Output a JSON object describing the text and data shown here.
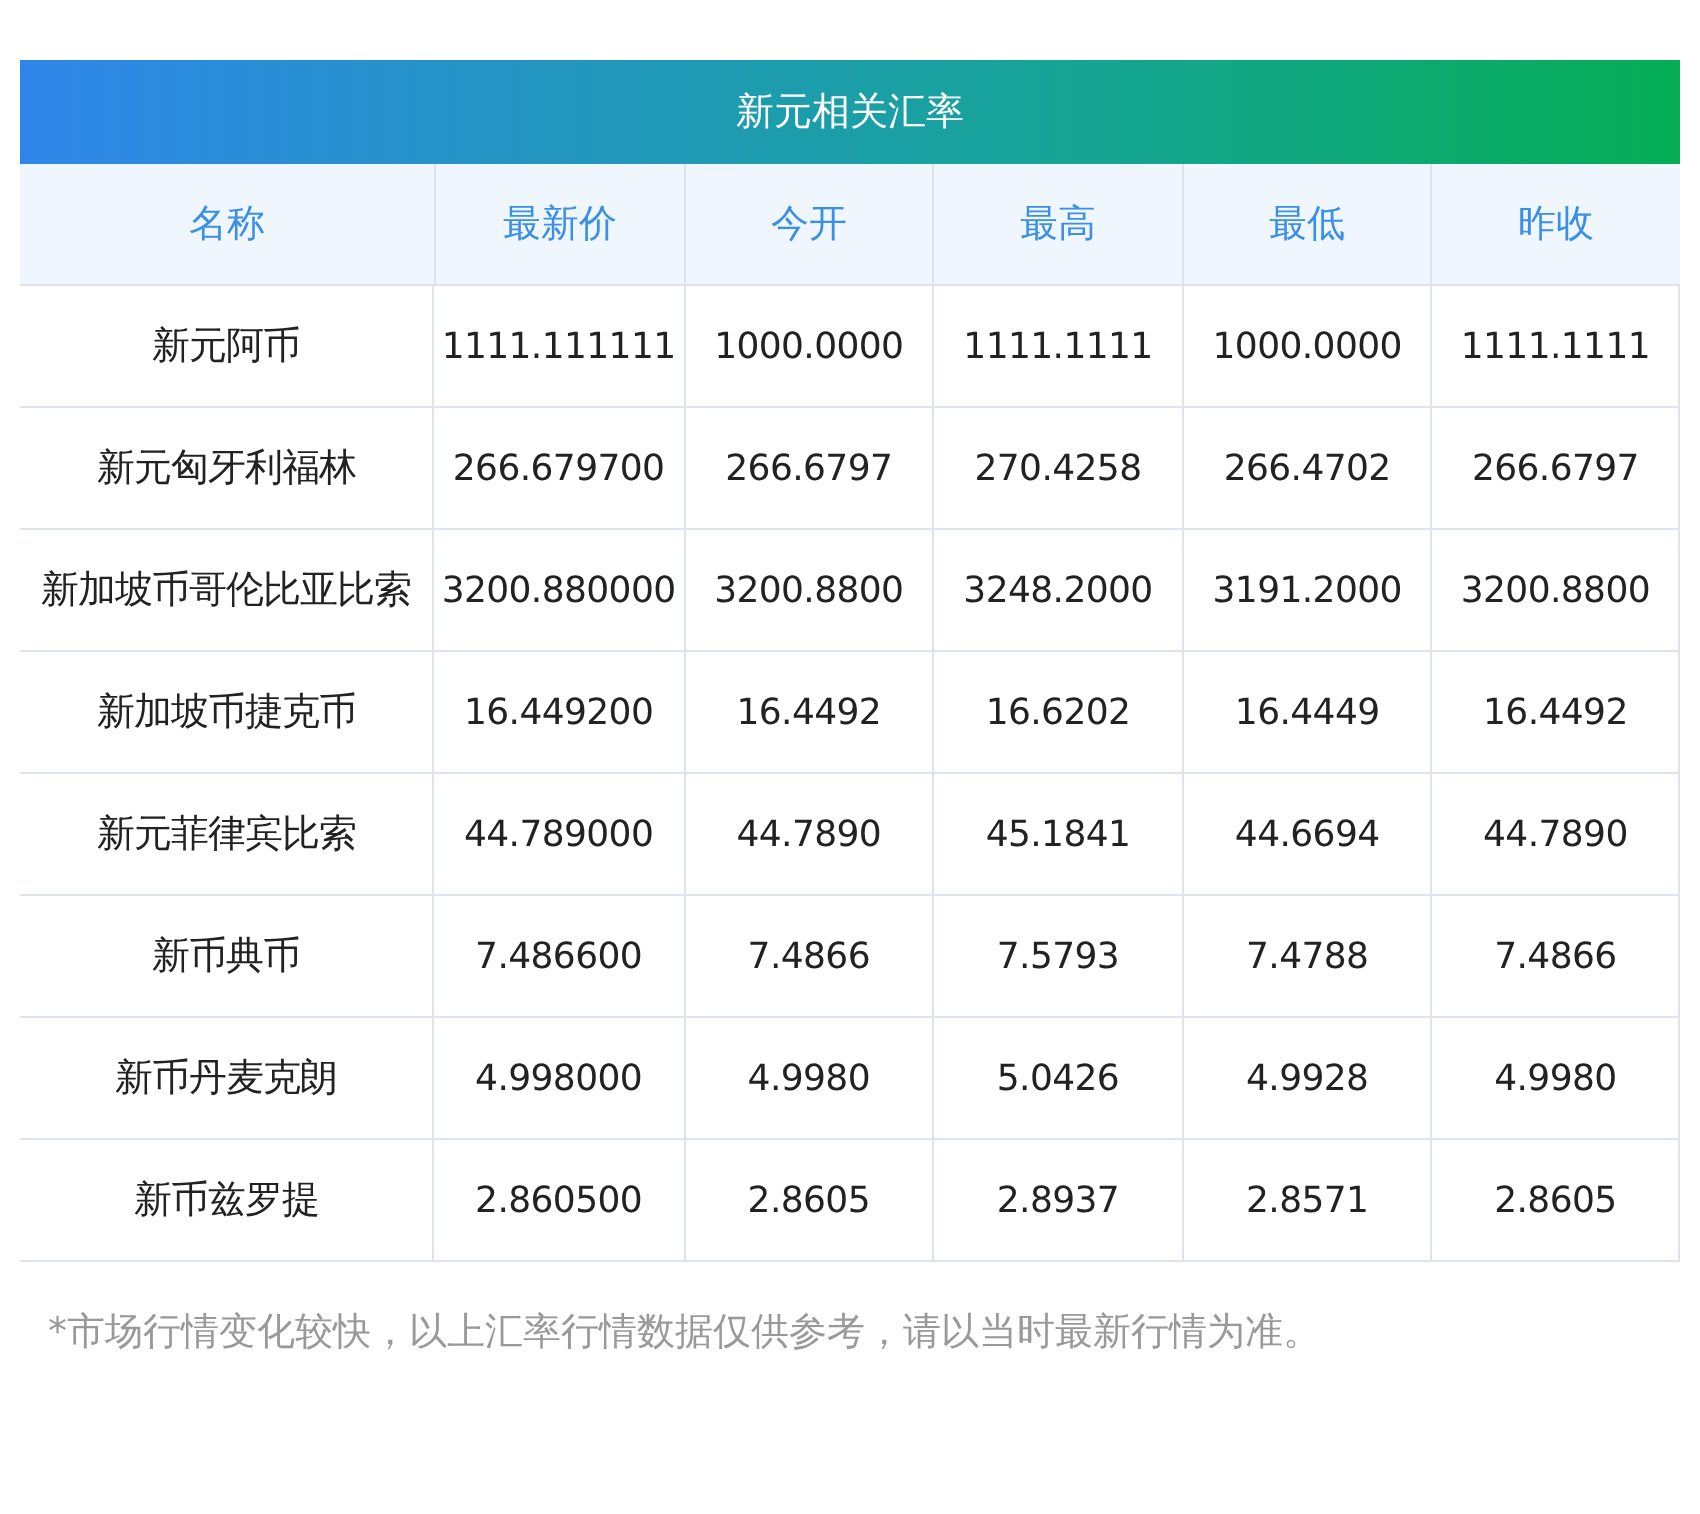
{
  "table": {
    "title": "新元相关汇率",
    "columns": [
      "名称",
      "最新价",
      "今开",
      "最高",
      "最低",
      "昨收"
    ],
    "rows": [
      {
        "name": "新元阿币",
        "values": [
          "1111.111111",
          "1000.0000",
          "1111.1111",
          "1000.0000",
          "1111.1111"
        ]
      },
      {
        "name": "新元匈牙利福林",
        "values": [
          "266.679700",
          "266.6797",
          "270.4258",
          "266.4702",
          "266.6797"
        ]
      },
      {
        "name": "新加坡币哥伦比亚比索",
        "values": [
          "3200.880000",
          "3200.8800",
          "3248.2000",
          "3191.2000",
          "3200.8800"
        ]
      },
      {
        "name": "新加坡币捷克币",
        "values": [
          "16.449200",
          "16.4492",
          "16.6202",
          "16.4449",
          "16.4492"
        ]
      },
      {
        "name": "新元菲律宾比索",
        "values": [
          "44.789000",
          "44.7890",
          "45.1841",
          "44.6694",
          "44.7890"
        ]
      },
      {
        "name": "新币典币",
        "values": [
          "7.486600",
          "7.4866",
          "7.5793",
          "7.4788",
          "7.4866"
        ]
      },
      {
        "name": "新币丹麦克朗",
        "values": [
          "4.998000",
          "4.9980",
          "5.0426",
          "4.9928",
          "4.9980"
        ]
      },
      {
        "name": "新币兹罗提",
        "values": [
          "2.860500",
          "2.8605",
          "2.8937",
          "2.8571",
          "2.8605"
        ]
      }
    ]
  },
  "footnote": "*市场行情变化较快，以上汇率行情数据仅供参考，请以当时最新行情为准。"
}
